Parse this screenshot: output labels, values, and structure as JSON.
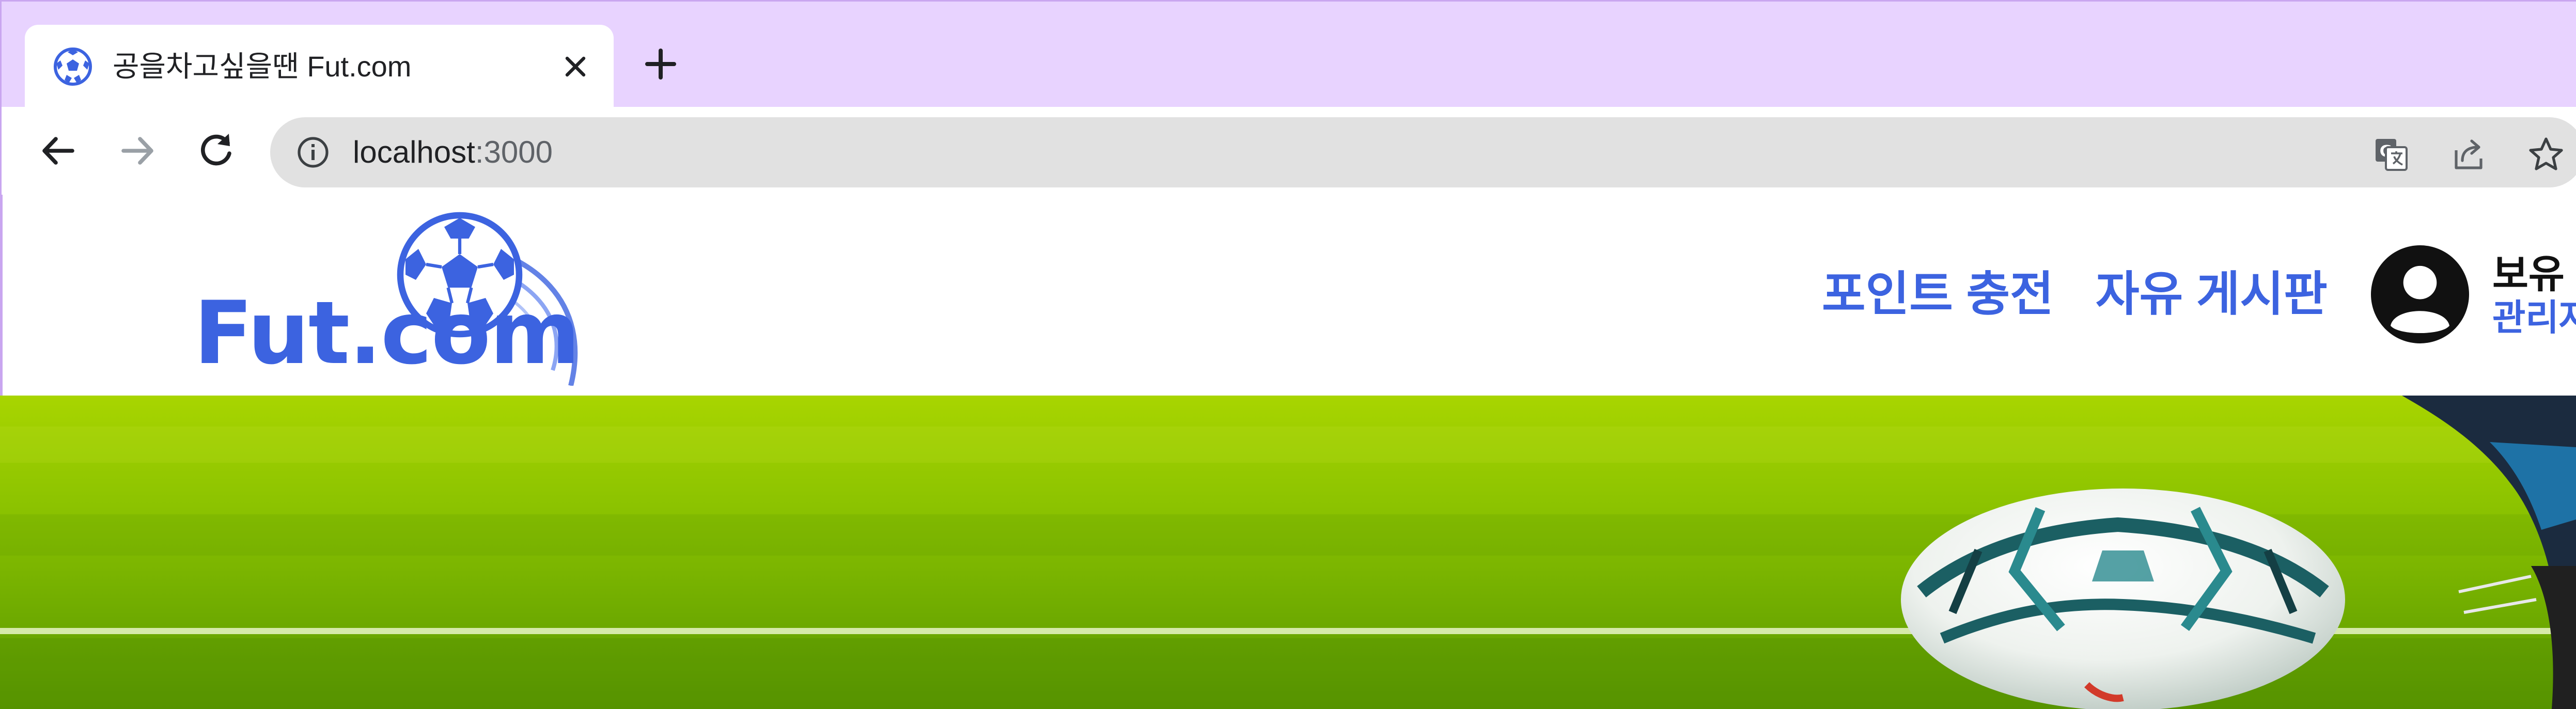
{
  "browser": {
    "tab": {
      "title": "공을차고싶을땐 Fut.com",
      "favicon": "soccer-ball-icon"
    },
    "new_tab_icon": "plus-icon",
    "nav": {
      "back_icon": "arrow-left-icon",
      "forward_icon": "arrow-right-icon",
      "reload_icon": "reload-icon"
    },
    "address": {
      "host": "localhost",
      "port": ":3000",
      "info_icon": "info-icon"
    },
    "omnibox_icons": [
      "translate-icon",
      "share-icon",
      "bookmark-star-icon"
    ]
  },
  "site": {
    "logo_text": "Fut.com",
    "nav": [
      {
        "label": "포인트 충전"
      },
      {
        "label": "자유 게시판"
      }
    ],
    "user": {
      "avatar_icon": "user-avatar-icon",
      "points_label": "보유 ",
      "role_label": "관리자"
    },
    "colors": {
      "accent": "#3c63e0",
      "tabstrip": "#e8d3ff",
      "grass": "#7fbc00"
    }
  }
}
